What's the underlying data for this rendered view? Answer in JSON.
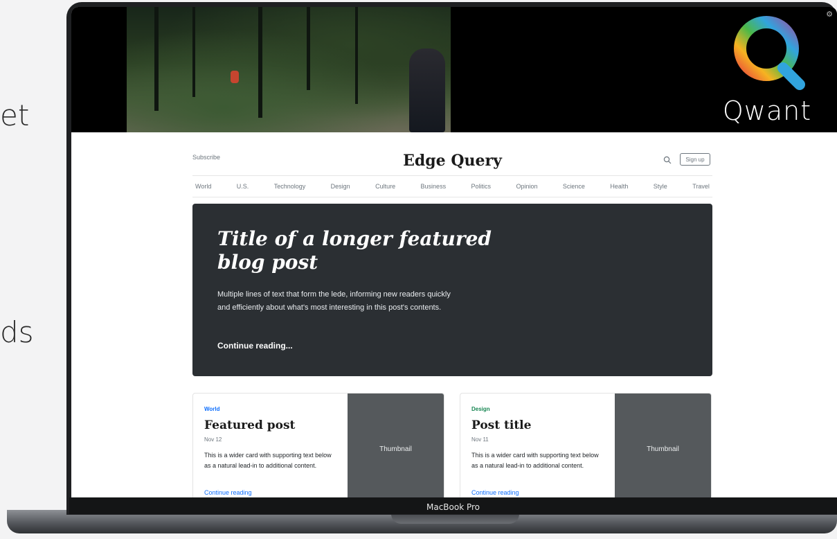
{
  "background_text": {
    "fragment_top": "et",
    "fragment_bottom": "ds"
  },
  "video": {
    "logo_word": "Qwant",
    "logo_colors": [
      "#e94b3c",
      "#f6b321",
      "#4cb848",
      "#31a4de",
      "#8e5ba8"
    ]
  },
  "device": {
    "label": "MacBook Pro"
  },
  "blog": {
    "header": {
      "subscribe": "Subscribe",
      "brand": "Edge Query",
      "signup": "Sign up"
    },
    "nav": [
      "World",
      "U.S.",
      "Technology",
      "Design",
      "Culture",
      "Business",
      "Politics",
      "Opinion",
      "Science",
      "Health",
      "Style",
      "Travel"
    ],
    "hero": {
      "title": "Title of a longer featured blog post",
      "lede": "Multiple lines of text that form the lede, informing new readers quickly and efficiently about what's most interesting in this post's contents.",
      "link": "Continue reading..."
    },
    "cards": [
      {
        "category": "World",
        "category_color": "#0d6efd",
        "title": "Featured post",
        "date": "Nov 12",
        "text": "This is a wider card with supporting text below as a natural lead-in to additional content.",
        "link": "Continue reading",
        "thumbnail": "Thumbnail"
      },
      {
        "category": "Design",
        "category_color": "#198754",
        "title": "Post title",
        "date": "Nov 11",
        "text": "This is a wider card with supporting text below as a natural lead-in to additional content.",
        "link": "Continue reading",
        "thumbnail": "Thumbnail"
      }
    ]
  }
}
